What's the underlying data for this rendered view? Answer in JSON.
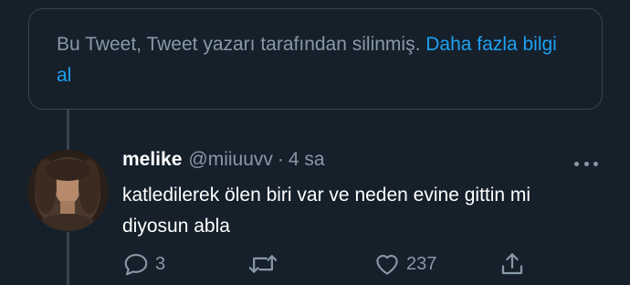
{
  "notice": {
    "text": "Bu Tweet, Tweet yazarı tarafından silinmiş.",
    "link": "Daha fazla bilgi al"
  },
  "tweet": {
    "display_name": "melike",
    "handle": "@miiuuvv",
    "separator": "·",
    "time": "4 sa",
    "text": "katledilerek ölen biri var ve neden evine gittin mi diyosun abla",
    "avatar_icon": "profile-photo",
    "more_icon": "more-dots-icon"
  },
  "actions": {
    "reply": {
      "icon": "reply-icon",
      "count": "3"
    },
    "retweet": {
      "icon": "retweet-icon",
      "count": ""
    },
    "like": {
      "icon": "heart-icon",
      "count": "237"
    },
    "share": {
      "icon": "share-icon",
      "count": ""
    }
  },
  "colors": {
    "background": "#15202b",
    "border": "#38444d",
    "muted": "#8899a6",
    "link": "#1da1f2",
    "text": "#ffffff"
  }
}
